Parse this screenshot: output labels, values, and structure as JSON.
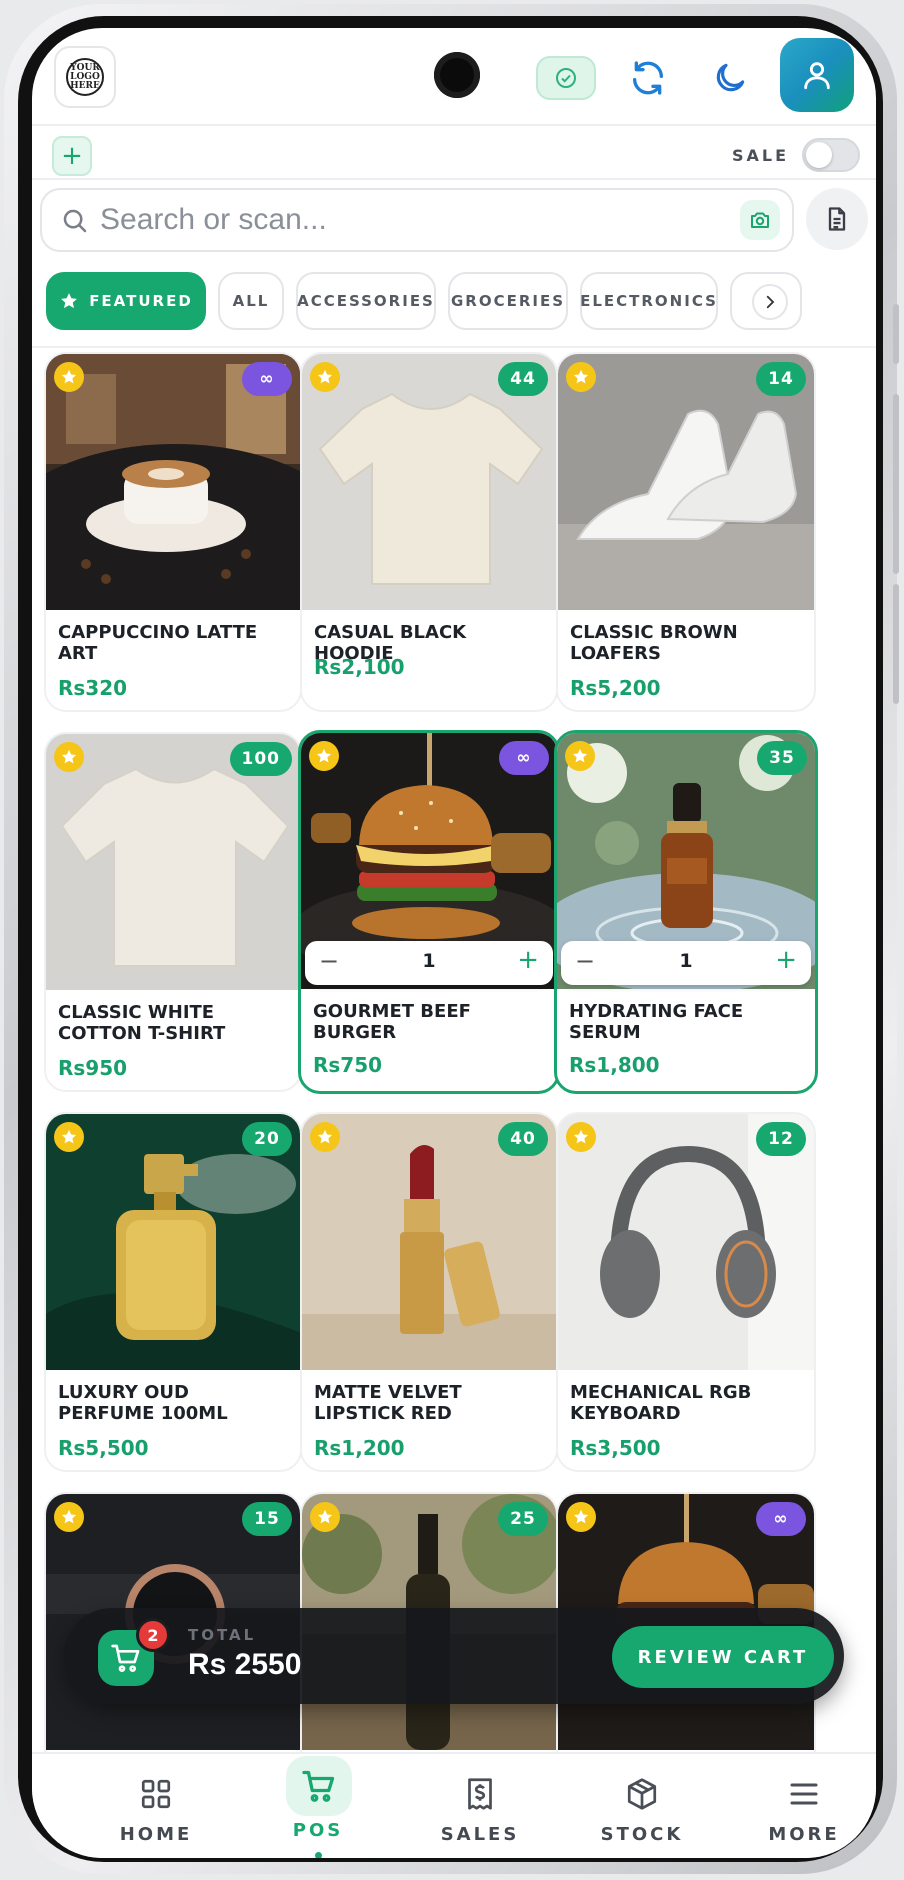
{
  "header": {
    "logo_text": "YOUR LOGO HERE",
    "check_icon": "check-circle-icon",
    "sync_icon": "sync-icon",
    "theme_icon": "moon-icon",
    "user_icon": "user-icon"
  },
  "toolbar": {
    "add_symbol": "+",
    "sale_label": "SALE",
    "sale_toggle_on": false
  },
  "search": {
    "placeholder": "Search or scan..."
  },
  "categories": [
    {
      "label": "FEATURED",
      "active": true
    },
    {
      "label": "ALL",
      "active": false
    },
    {
      "label": "ACCESSORIES",
      "active": false
    },
    {
      "label": "GROCERIES",
      "active": false
    },
    {
      "label": "ELECTRONICS",
      "active": false
    }
  ],
  "products": [
    {
      "name": "CAPPUCCINO LATTE ART",
      "price": "Rs320",
      "stock": "∞"
    },
    {
      "name": "CASUAL BLACK HOODIE",
      "price": "Rs2,100",
      "stock": "44"
    },
    {
      "name": "CLASSIC BROWN LOAFERS",
      "price": "Rs5,200",
      "stock": "14"
    },
    {
      "name": "CLASSIC WHITE COTTON T-SHIRT",
      "price": "Rs950",
      "stock": "100"
    },
    {
      "name": "GOURMET BEEF BURGER",
      "price": "Rs750",
      "stock": "∞",
      "qty": "1"
    },
    {
      "name": "HYDRATING FACE SERUM",
      "price": "Rs1,800",
      "stock": "35",
      "qty": "1"
    },
    {
      "name": "LUXURY OUD PERFUME 100ML",
      "price": "Rs5,500",
      "stock": "20"
    },
    {
      "name": "MATTE VELVET LIPSTICK RED",
      "price": "Rs1,200",
      "stock": "40"
    },
    {
      "name": "MECHANICAL RGB KEYBOARD",
      "price": "Rs3,500",
      "stock": "12"
    },
    {
      "name": "",
      "price": "",
      "stock": "15"
    },
    {
      "name": "",
      "price": "",
      "stock": "25"
    },
    {
      "name": "",
      "price": "",
      "stock": "∞"
    }
  ],
  "cart": {
    "count": "2",
    "total_label": "TOTAL",
    "total_value": "Rs 2550",
    "review_label": "REVIEW CART"
  },
  "nav": [
    {
      "label": "HOME",
      "icon": "grid-icon"
    },
    {
      "label": "POS",
      "icon": "cart-icon",
      "active": true
    },
    {
      "label": "SALES",
      "icon": "receipt-icon"
    },
    {
      "label": "STOCK",
      "icon": "box-icon"
    },
    {
      "label": "MORE",
      "icon": "menu-icon"
    }
  ],
  "colors": {
    "accent": "#17a870",
    "infinite_badge": "#7b55e0",
    "star": "#f5c518",
    "cart_badge": "#e53a3a"
  }
}
